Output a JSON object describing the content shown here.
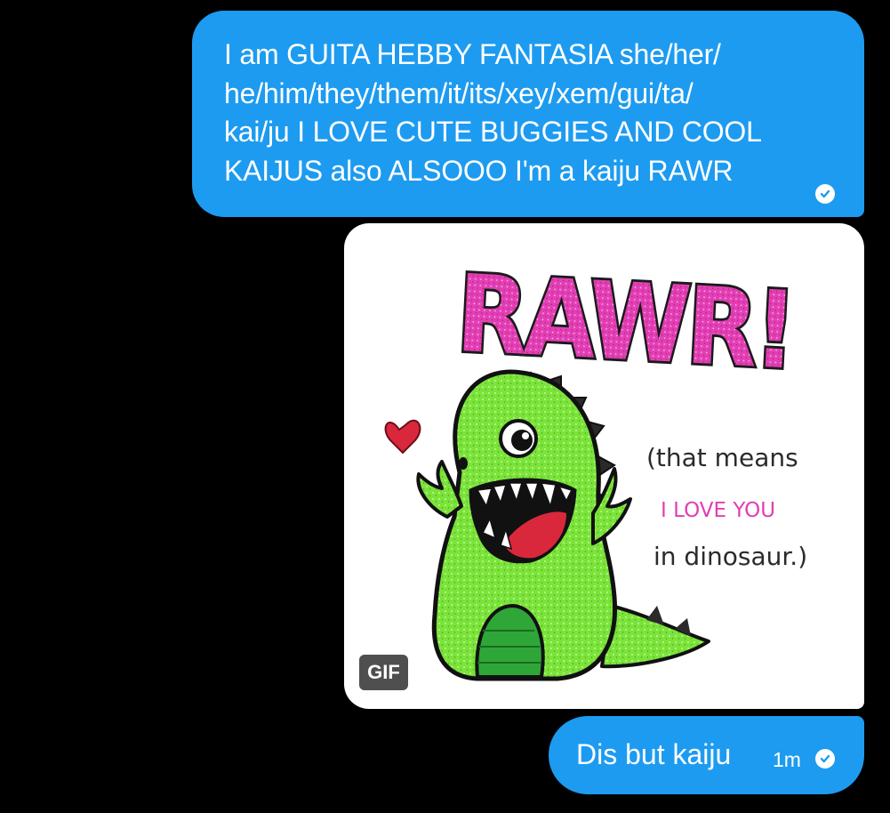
{
  "messages": [
    {
      "type": "text",
      "text": "I am GUITA HEBBY FANTASIA  she/her/\nhe/him/they/them/it/its/xey/xem/gui/ta/\nkai/ju I LOVE CUTE BUGGIES AND COOL\nKAIJUS also ALSOOO I'm a kaiju RAWR",
      "status_icon": "sent-check-icon"
    },
    {
      "type": "gif",
      "badge": "GIF",
      "caption": {
        "title": "RAWR!",
        "line1": "(that means",
        "line2": "I LOVE YOU",
        "line3": "in dinosaur.)"
      }
    },
    {
      "type": "text",
      "text": "Dis but kaiju",
      "time": "1m",
      "status_icon": "sent-check-icon"
    }
  ],
  "colors": {
    "background": "#000000",
    "bubble": "#1d9bf0",
    "bubble_text": "#ffffff",
    "gif_badge": "#4f4f4f",
    "rawr_pink": "#e23fb4",
    "dino_green": "#7be33a",
    "heart_red": "#d9283c"
  }
}
